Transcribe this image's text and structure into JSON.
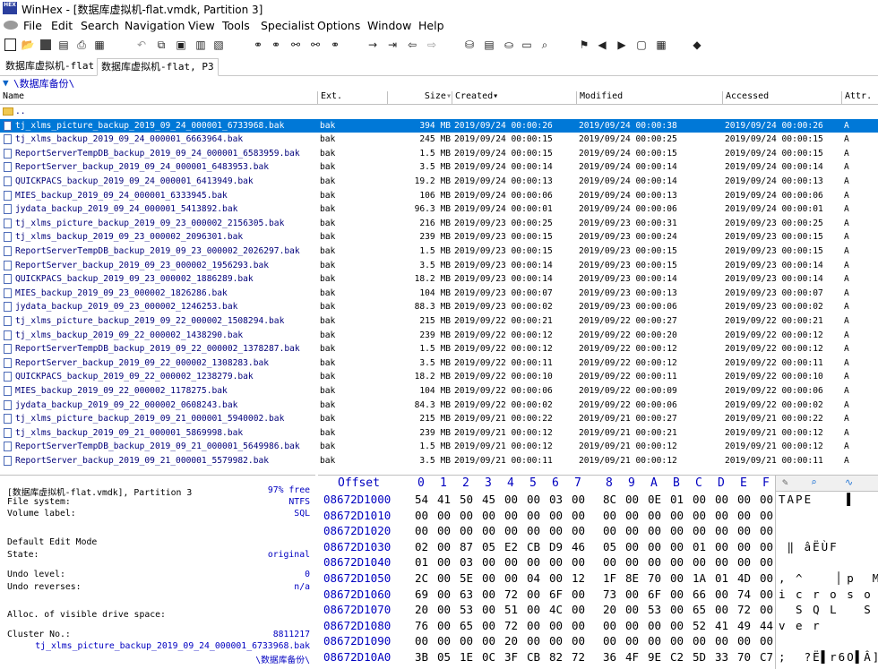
{
  "window": {
    "app_icon_text": "HEX",
    "title": "WinHex - [数据库虚拟机-flat.vmdk, Partition 3]"
  },
  "menu": [
    "File",
    "Edit",
    "Search",
    "Navigation",
    "View",
    "Tools",
    "Specialist",
    "Options",
    "Window",
    "Help"
  ],
  "toolbar": {
    "icons": [
      "new-file-icon",
      "open-icon",
      "save-icon",
      "save-all-icon",
      "print-icon",
      "properties-icon",
      "undo-icon",
      "copy-icon",
      "clipboard-icon",
      "paste-icon",
      "write-icon",
      "binoculars-icon",
      "find-hex-icon",
      "replace-text-icon",
      "replace-hex-icon",
      "find-next-icon",
      "goto-offset-icon",
      "goto-sector-icon",
      "back-icon",
      "forward-icon",
      "open-disk-icon",
      "ram-icon",
      "disk-icon",
      "tape-icon",
      "analyze-icon",
      "search-icon",
      "directory-browser-icon",
      "prev-icon",
      "next-icon",
      "snapshot-icon",
      "table-icon",
      "calc-icon",
      "bookmark-icon"
    ]
  },
  "tabs": [
    {
      "label": "数据库虚拟机-flat",
      "active": false
    },
    {
      "label": "数据库虚拟机-flat, P3",
      "active": true
    }
  ],
  "path": "\\数据库备份\\",
  "columns": {
    "name": "Name",
    "ext": "Ext.",
    "size": "Size",
    "created": "Created",
    "modified": "Modified",
    "accessed": "Accessed",
    "attr": "Attr."
  },
  "parent_entry": "..",
  "files": [
    {
      "name": "tj_xlms_picture_backup_2019_09_24_000001_6733968.bak",
      "ext": "bak",
      "size": "394 MB",
      "created": "2019/09/24  00:00:26",
      "modified": "2019/09/24  00:00:38",
      "accessed": "2019/09/24  00:00:26",
      "attr": "A"
    },
    {
      "name": "tj_xlms_backup_2019_09_24_000001_6663964.bak",
      "ext": "bak",
      "size": "245 MB",
      "created": "2019/09/24  00:00:15",
      "modified": "2019/09/24  00:00:25",
      "accessed": "2019/09/24  00:00:15",
      "attr": "A"
    },
    {
      "name": "ReportServerTempDB_backup_2019_09_24_000001_6583959.bak",
      "ext": "bak",
      "size": "1.5 MB",
      "created": "2019/09/24  00:00:15",
      "modified": "2019/09/24  00:00:15",
      "accessed": "2019/09/24  00:00:15",
      "attr": "A"
    },
    {
      "name": "ReportServer_backup_2019_09_24_000001_6483953.bak",
      "ext": "bak",
      "size": "3.5 MB",
      "created": "2019/09/24  00:00:14",
      "modified": "2019/09/24  00:00:14",
      "accessed": "2019/09/24  00:00:14",
      "attr": "A"
    },
    {
      "name": "QUICKPACS_backup_2019_09_24_000001_6413949.bak",
      "ext": "bak",
      "size": "19.2 MB",
      "created": "2019/09/24  00:00:13",
      "modified": "2019/09/24  00:00:14",
      "accessed": "2019/09/24  00:00:13",
      "attr": "A"
    },
    {
      "name": "MIES_backup_2019_09_24_000001_6333945.bak",
      "ext": "bak",
      "size": "106 MB",
      "created": "2019/09/24  00:00:06",
      "modified": "2019/09/24  00:00:13",
      "accessed": "2019/09/24  00:00:06",
      "attr": "A"
    },
    {
      "name": "jydata_backup_2019_09_24_000001_5413892.bak",
      "ext": "bak",
      "size": "96.3 MB",
      "created": "2019/09/24  00:00:01",
      "modified": "2019/09/24  00:00:06",
      "accessed": "2019/09/24  00:00:01",
      "attr": "A"
    },
    {
      "name": "tj_xlms_picture_backup_2019_09_23_000002_2156305.bak",
      "ext": "bak",
      "size": "216 MB",
      "created": "2019/09/23  00:00:25",
      "modified": "2019/09/23  00:00:31",
      "accessed": "2019/09/23  00:00:25",
      "attr": "A"
    },
    {
      "name": "tj_xlms_backup_2019_09_23_000002_2096301.bak",
      "ext": "bak",
      "size": "239 MB",
      "created": "2019/09/23  00:00:15",
      "modified": "2019/09/23  00:00:24",
      "accessed": "2019/09/23  00:00:15",
      "attr": "A"
    },
    {
      "name": "ReportServerTempDB_backup_2019_09_23_000002_2026297.bak",
      "ext": "bak",
      "size": "1.5 MB",
      "created": "2019/09/23  00:00:15",
      "modified": "2019/09/23  00:00:15",
      "accessed": "2019/09/23  00:00:15",
      "attr": "A"
    },
    {
      "name": "ReportServer_backup_2019_09_23_000002_1956293.bak",
      "ext": "bak",
      "size": "3.5 MB",
      "created": "2019/09/23  00:00:14",
      "modified": "2019/09/23  00:00:15",
      "accessed": "2019/09/23  00:00:14",
      "attr": "A"
    },
    {
      "name": "QUICKPACS_backup_2019_09_23_000002_1886289.bak",
      "ext": "bak",
      "size": "18.2 MB",
      "created": "2019/09/23  00:00:14",
      "modified": "2019/09/23  00:00:14",
      "accessed": "2019/09/23  00:00:14",
      "attr": "A"
    },
    {
      "name": "MIES_backup_2019_09_23_000002_1826286.bak",
      "ext": "bak",
      "size": "104 MB",
      "created": "2019/09/23  00:00:07",
      "modified": "2019/09/23  00:00:13",
      "accessed": "2019/09/23  00:00:07",
      "attr": "A"
    },
    {
      "name": "jydata_backup_2019_09_23_000002_1246253.bak",
      "ext": "bak",
      "size": "88.3 MB",
      "created": "2019/09/23  00:00:02",
      "modified": "2019/09/23  00:00:06",
      "accessed": "2019/09/23  00:00:02",
      "attr": "A"
    },
    {
      "name": "tj_xlms_picture_backup_2019_09_22_000002_1508294.bak",
      "ext": "bak",
      "size": "215 MB",
      "created": "2019/09/22  00:00:21",
      "modified": "2019/09/22  00:00:27",
      "accessed": "2019/09/22  00:00:21",
      "attr": "A"
    },
    {
      "name": "tj_xlms_backup_2019_09_22_000002_1438290.bak",
      "ext": "bak",
      "size": "239 MB",
      "created": "2019/09/22  00:00:12",
      "modified": "2019/09/22  00:00:20",
      "accessed": "2019/09/22  00:00:12",
      "attr": "A"
    },
    {
      "name": "ReportServerTempDB_backup_2019_09_22_000002_1378287.bak",
      "ext": "bak",
      "size": "1.5 MB",
      "created": "2019/09/22  00:00:12",
      "modified": "2019/09/22  00:00:12",
      "accessed": "2019/09/22  00:00:12",
      "attr": "A"
    },
    {
      "name": "ReportServer_backup_2019_09_22_000002_1308283.bak",
      "ext": "bak",
      "size": "3.5 MB",
      "created": "2019/09/22  00:00:11",
      "modified": "2019/09/22  00:00:12",
      "accessed": "2019/09/22  00:00:11",
      "attr": "A"
    },
    {
      "name": "QUICKPACS_backup_2019_09_22_000002_1238279.bak",
      "ext": "bak",
      "size": "18.2 MB",
      "created": "2019/09/22  00:00:10",
      "modified": "2019/09/22  00:00:11",
      "accessed": "2019/09/22  00:00:10",
      "attr": "A"
    },
    {
      "name": "MIES_backup_2019_09_22_000002_1178275.bak",
      "ext": "bak",
      "size": "104 MB",
      "created": "2019/09/22  00:00:06",
      "modified": "2019/09/22  00:00:09",
      "accessed": "2019/09/22  00:00:06",
      "attr": "A"
    },
    {
      "name": "jydata_backup_2019_09_22_000002_0608243.bak",
      "ext": "bak",
      "size": "84.3 MB",
      "created": "2019/09/22  00:00:02",
      "modified": "2019/09/22  00:00:06",
      "accessed": "2019/09/22  00:00:02",
      "attr": "A"
    },
    {
      "name": "tj_xlms_picture_backup_2019_09_21_000001_5940002.bak",
      "ext": "bak",
      "size": "215 MB",
      "created": "2019/09/21  00:00:22",
      "modified": "2019/09/21  00:00:27",
      "accessed": "2019/09/21  00:00:22",
      "attr": "A"
    },
    {
      "name": "tj_xlms_backup_2019_09_21_000001_5869998.bak",
      "ext": "bak",
      "size": "239 MB",
      "created": "2019/09/21  00:00:12",
      "modified": "2019/09/21  00:00:21",
      "accessed": "2019/09/21  00:00:12",
      "attr": "A"
    },
    {
      "name": "ReportServerTempDB_backup_2019_09_21_000001_5649986.bak",
      "ext": "bak",
      "size": "1.5 MB",
      "created": "2019/09/21  00:00:12",
      "modified": "2019/09/21  00:00:12",
      "accessed": "2019/09/21  00:00:12",
      "attr": "A"
    },
    {
      "name": "ReportServer_backup_2019_09_21_000001_5579982.bak",
      "ext": "bak",
      "size": "3.5 MB",
      "created": "2019/09/21  00:00:11",
      "modified": "2019/09/21  00:00:12",
      "accessed": "2019/09/21  00:00:11",
      "attr": "A"
    }
  ],
  "info": {
    "volume": "[数据库虚拟机-flat.vmdk], Partition 3",
    "free": "97% free",
    "fs_label": "File system:",
    "fs_value": "NTFS",
    "vol_label": "Volume label:",
    "vol_value": "SQL",
    "edit_mode_label": "Default Edit Mode",
    "state_label": "State:",
    "state_value": "original",
    "undo_level_label": "Undo level:",
    "undo_level_value": "0",
    "undo_rev_label": "Undo reverses:",
    "undo_rev_value": "n/a",
    "alloc_label": "Alloc. of visible drive space:",
    "cluster_label": "Cluster No.:",
    "cluster_value": "8811217",
    "cluster_file": "tj_xlms_picture_backup_2019_09_24_000001_6733968.bak",
    "cluster_path": "\\数据库备份\\"
  },
  "hex": {
    "offset_label": "Offset",
    "columns": [
      "0",
      "1",
      "2",
      "3",
      "4",
      "5",
      "6",
      "7",
      "8",
      "9",
      "A",
      "B",
      "C",
      "D",
      "E",
      "F"
    ],
    "rows": [
      {
        "offset": "08672D1000",
        "bytes": [
          "54",
          "41",
          "50",
          "45",
          "00",
          "00",
          "03",
          "00",
          "8C",
          "00",
          "0E",
          "01",
          "00",
          "00",
          "00",
          "00"
        ],
        "ascii": "TAPE    ▌"
      },
      {
        "offset": "08672D1010",
        "bytes": [
          "00",
          "00",
          "00",
          "00",
          "00",
          "00",
          "00",
          "00",
          "00",
          "00",
          "00",
          "00",
          "00",
          "00",
          "00",
          "00"
        ],
        "ascii": ""
      },
      {
        "offset": "08672D1020",
        "bytes": [
          "00",
          "00",
          "00",
          "00",
          "00",
          "00",
          "00",
          "00",
          "00",
          "00",
          "00",
          "00",
          "00",
          "00",
          "00",
          "00"
        ],
        "ascii": ""
      },
      {
        "offset": "08672D1030",
        "bytes": [
          "02",
          "00",
          "87",
          "05",
          "E2",
          "CB",
          "D9",
          "46",
          "05",
          "00",
          "00",
          "00",
          "01",
          "00",
          "00",
          "00"
        ],
        "ascii": " ‖ âËÙF"
      },
      {
        "offset": "08672D1040",
        "bytes": [
          "01",
          "00",
          "03",
          "00",
          "00",
          "00",
          "00",
          "00",
          "00",
          "00",
          "00",
          "00",
          "00",
          "00",
          "00",
          "00"
        ],
        "ascii": ""
      },
      {
        "offset": "08672D1050",
        "bytes": [
          "2C",
          "00",
          "5E",
          "00",
          "00",
          "04",
          "00",
          "12",
          "1F",
          "8E",
          "70",
          "00",
          "1A",
          "01",
          "4D",
          "00"
        ],
        "ascii": ", ^    ▏p  M"
      },
      {
        "offset": "08672D1060",
        "bytes": [
          "69",
          "00",
          "63",
          "00",
          "72",
          "00",
          "6F",
          "00",
          "73",
          "00",
          "6F",
          "00",
          "66",
          "00",
          "74",
          "00"
        ],
        "ascii": "i c r o s o f t"
      },
      {
        "offset": "08672D1070",
        "bytes": [
          "20",
          "00",
          "53",
          "00",
          "51",
          "00",
          "4C",
          "00",
          "20",
          "00",
          "53",
          "00",
          "65",
          "00",
          "72",
          "00"
        ],
        "ascii": "  S Q L   S e r"
      },
      {
        "offset": "08672D1080",
        "bytes": [
          "76",
          "00",
          "65",
          "00",
          "72",
          "00",
          "00",
          "00",
          "00",
          "00",
          "00",
          "00",
          "52",
          "41",
          "49",
          "44"
        ],
        "ascii": "v e r       RAID"
      },
      {
        "offset": "08672D1090",
        "bytes": [
          "00",
          "00",
          "00",
          "00",
          "20",
          "00",
          "00",
          "00",
          "00",
          "00",
          "00",
          "00",
          "00",
          "00",
          "00",
          "00"
        ],
        "ascii": ""
      },
      {
        "offset": "08672D10A0",
        "bytes": [
          "3B",
          "05",
          "1E",
          "0C",
          "3F",
          "CB",
          "82",
          "72",
          "36",
          "4F",
          "9E",
          "C2",
          "5D",
          "33",
          "70",
          "C7"
        ],
        "ascii": ";  ?Ë▌r6O▌Â]3pÇ"
      }
    ]
  }
}
